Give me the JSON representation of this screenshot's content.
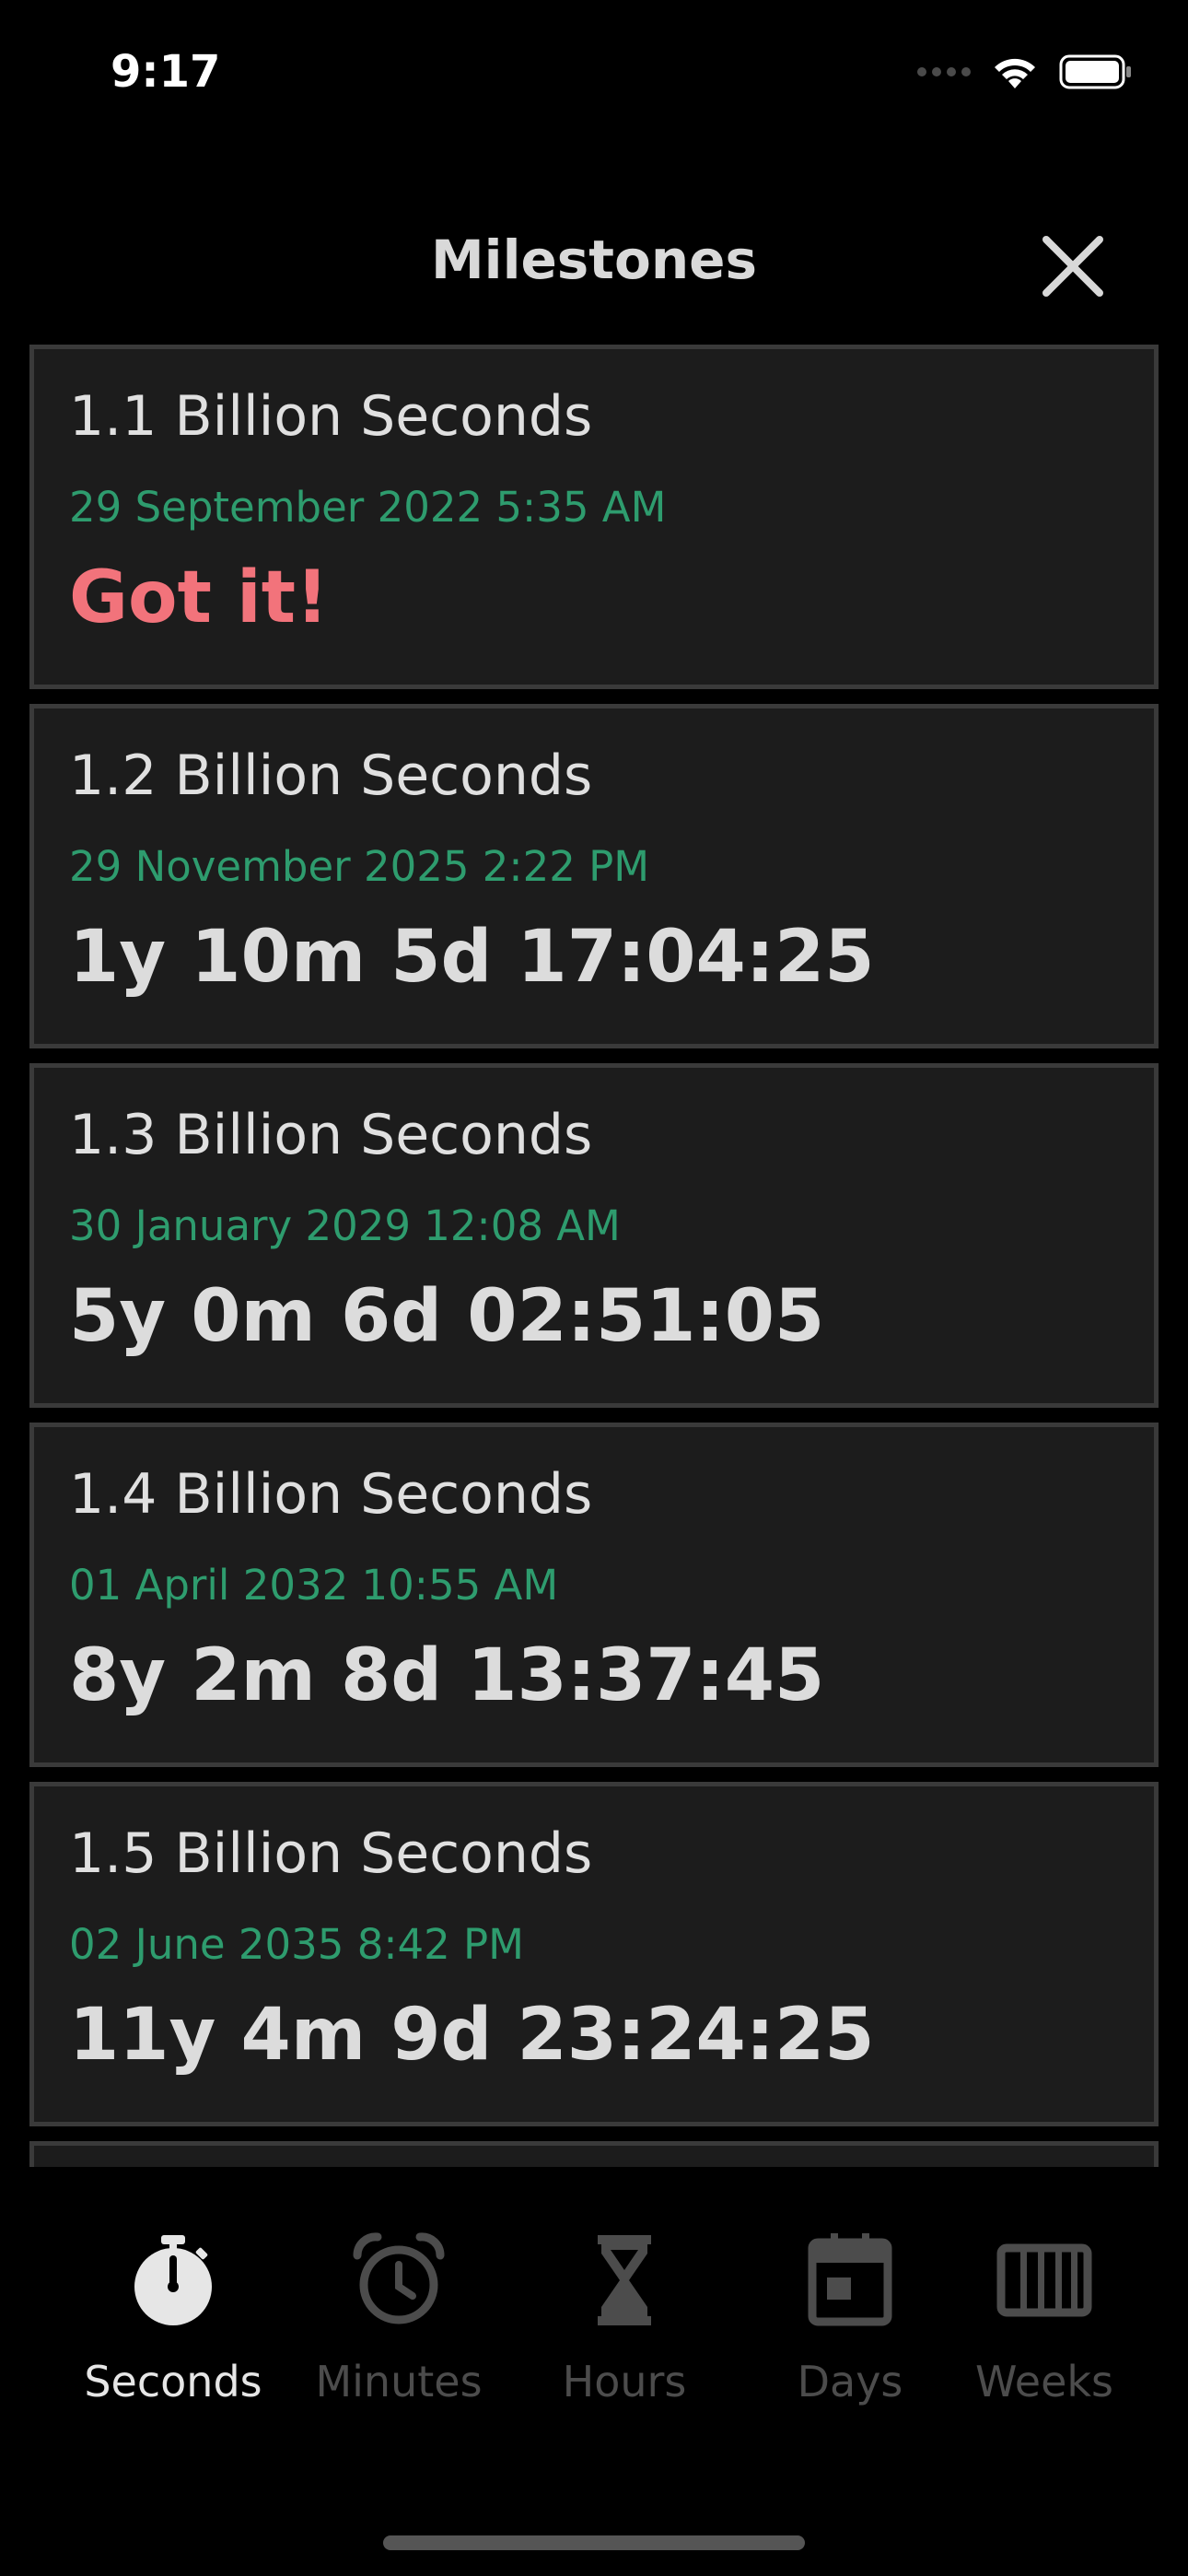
{
  "status_bar": {
    "time": "9:17"
  },
  "header": {
    "title": "Milestones",
    "close_icon": "close-icon"
  },
  "milestones": [
    {
      "title": "1.1 Billion Seconds",
      "date": "29 September 2022 5:35 AM",
      "value": "Got it!",
      "achieved": true
    },
    {
      "title": "1.2 Billion Seconds",
      "date": "29 November 2025 2:22 PM",
      "value": "1y 10m 5d 17:04:25",
      "achieved": false
    },
    {
      "title": "1.3 Billion Seconds",
      "date": "30 January 2029 12:08 AM",
      "value": "5y 0m 6d 02:51:05",
      "achieved": false
    },
    {
      "title": "1.4 Billion Seconds",
      "date": "01 April 2032 10:55 AM",
      "value": "8y 2m 8d 13:37:45",
      "achieved": false
    },
    {
      "title": "1.5 Billion Seconds",
      "date": "02 June 2035 8:42 PM",
      "value": "11y 4m 9d 23:24:25",
      "achieved": false
    }
  ],
  "tabs": [
    {
      "label": "Seconds",
      "icon": "stopwatch-icon",
      "active": true
    },
    {
      "label": "Minutes",
      "icon": "alarm-clock-icon",
      "active": false
    },
    {
      "label": "Hours",
      "icon": "hourglass-icon",
      "active": false
    },
    {
      "label": "Days",
      "icon": "calendar-icon",
      "active": false
    },
    {
      "label": "Weeks",
      "icon": "week-grid-icon",
      "active": false
    }
  ],
  "colors": {
    "background": "#000000",
    "card": "#1c1c1c",
    "card_border": "#3a3a3a",
    "date_green": "#2e9c6e",
    "achieved_red": "#f2737b",
    "active_tab": "#e6e6e6",
    "inactive_tab": "#4c4c4c"
  }
}
